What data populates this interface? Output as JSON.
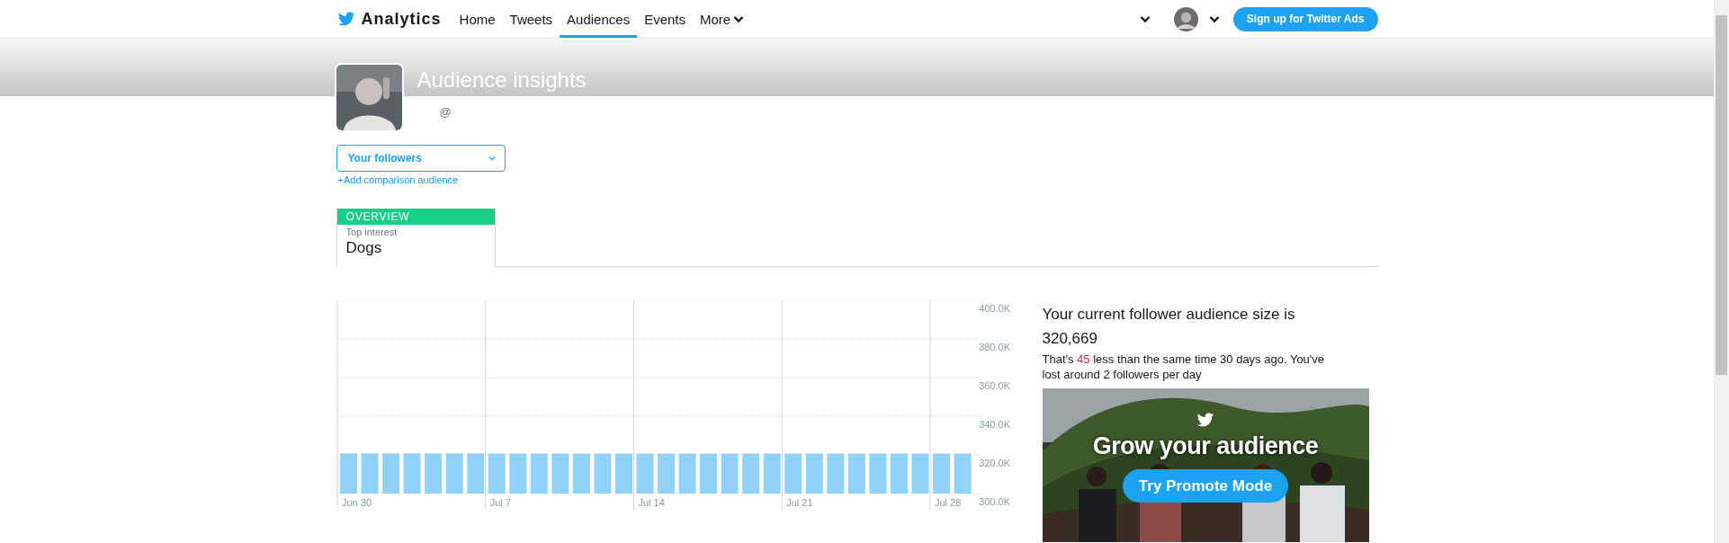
{
  "nav": {
    "brand": "Analytics",
    "items": [
      {
        "label": "Home",
        "selected": false,
        "kind": "link"
      },
      {
        "label": "Tweets",
        "selected": false,
        "kind": "link"
      },
      {
        "label": "Audiences",
        "selected": true,
        "kind": "link"
      },
      {
        "label": "Events",
        "selected": false,
        "kind": "link"
      },
      {
        "label": "More",
        "selected": false,
        "kind": "menu"
      }
    ],
    "ads_button": "Sign up for Twitter Ads"
  },
  "header": {
    "title": "Audience insights",
    "handle": "@"
  },
  "audience_select": {
    "value": "Your followers"
  },
  "add_link": "+Add comparison audience",
  "tabs": [
    {
      "label": "OVERVIEW",
      "selected": true,
      "caption": "Top interest",
      "value": "Dogs"
    }
  ],
  "chart_data": {
    "type": "bar",
    "categories": [
      "Jun 30",
      null,
      null,
      null,
      null,
      null,
      null,
      "Jul 7",
      null,
      null,
      null,
      null,
      null,
      null,
      "Jul 14",
      null,
      null,
      null,
      null,
      null,
      null,
      "Jul 21",
      null,
      null,
      null,
      null,
      null,
      null,
      "Jul 28",
      null
    ],
    "grid": true,
    "series": [
      {
        "color": "#91d2fa",
        "values": [
          320800,
          320800,
          320800,
          320800,
          320800,
          320800,
          320800,
          320700,
          320700,
          320700,
          320700,
          320700,
          320700,
          320700,
          320700,
          320700,
          320700,
          320700,
          320700,
          320700,
          320700,
          320700,
          320700,
          320700,
          320700,
          320700,
          320700,
          320700,
          320700,
          320700
        ]
      }
    ],
    "ylim": [
      300000,
      400000
    ],
    "yticks": [
      {
        "value": 300000,
        "label": "300.0K"
      },
      {
        "value": 320000,
        "label": "320.0K"
      },
      {
        "value": 340000,
        "label": "340.0K"
      },
      {
        "value": 360000,
        "label": "360.0K"
      },
      {
        "value": 380000,
        "label": "380.0K"
      },
      {
        "value": 400000,
        "label": "400.0K"
      }
    ]
  },
  "summary": {
    "heading": "Your current follower audience size is",
    "count": "320,669",
    "note": [
      {
        "text": "That's ",
        "highlight": false
      },
      {
        "text": "45",
        "highlight": true
      },
      {
        "text": " less than the same time 30 days ago. You've lost around 2 followers per day",
        "highlight": false
      }
    ]
  },
  "promo": {
    "headline": "Grow your audience",
    "button": "Try Promote Mode"
  }
}
